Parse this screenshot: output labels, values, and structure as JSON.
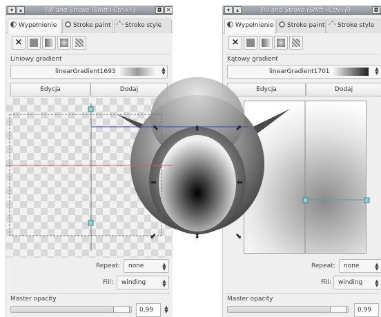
{
  "left_panel": {
    "title": "Fill and Stroke (Shift+Ctrl+F)",
    "title_buttons": [
      "▾",
      "▴",
      "◘",
      "✕"
    ],
    "tabs": [
      {
        "label": "Wypełnienie",
        "icon": "fill-icon"
      },
      {
        "label": "Stroke paint",
        "icon": "stroke-paint-icon"
      },
      {
        "label": "Stroke style",
        "icon": "stroke-style-icon"
      }
    ],
    "paint_buttons": [
      "no-paint",
      "flat-color",
      "linear-gradient",
      "radial-gradient",
      "pattern"
    ],
    "no_paint_glyph": "×",
    "gradient_type_label": "Liniowy gradient",
    "gradient_name": "linearGradient1693",
    "edit_button": "Edycja",
    "add_button": "Dodaj",
    "repeat_label": "Repeat:",
    "repeat_value": "none",
    "fill_label": "Fill:",
    "fill_value": "winding",
    "master_opacity_label": "Master opacity",
    "opacity_value": "0,99"
  },
  "right_panel": {
    "title": "Fill and Stroke (Shift+Ctrl+F)",
    "title_buttons": [
      "▾",
      "▴",
      "◘"
    ],
    "tabs": [
      {
        "label": "Wypełnienie",
        "icon": "fill-icon"
      },
      {
        "label": "Stroke paint",
        "icon": "stroke-paint-icon"
      },
      {
        "label": "Stroke style",
        "icon": "stroke-style-icon"
      }
    ],
    "paint_buttons": [
      "no-paint",
      "flat-color",
      "linear-gradient",
      "radial-gradient",
      "pattern"
    ],
    "no_paint_glyph": "×",
    "gradient_type_label": "Kątowy gradient",
    "gradient_name": "linearGradient1701",
    "edit_button": "Edycja",
    "add_button": "Dodaj",
    "repeat_label": "Repeat:",
    "repeat_value": "none",
    "fill_label": "Fill:",
    "fill_value": "winding",
    "master_opacity_label": "Master opacity",
    "opacity_value": "0,99"
  },
  "colors": {
    "titlebar": "#9ea3aa",
    "handle": "#8fd3d8",
    "guide_blue": "#3d3dcf",
    "guide_red": "#d45a5a"
  }
}
